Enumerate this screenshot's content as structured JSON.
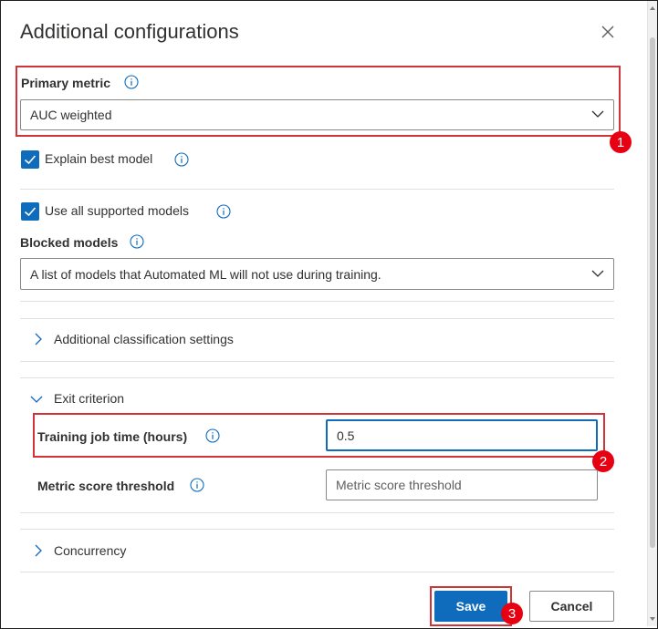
{
  "dialog": {
    "title": "Additional configurations",
    "close_icon": "close-icon"
  },
  "primary_metric": {
    "label": "Primary metric",
    "value": "AUC weighted"
  },
  "explain_best_model": {
    "label": "Explain best model",
    "checked": true
  },
  "use_all_models": {
    "label": "Use all supported models",
    "checked": true
  },
  "blocked_models": {
    "label": "Blocked models",
    "placeholder": "A list of models that Automated ML will not use during training."
  },
  "sections": {
    "classification": {
      "label": "Additional classification settings",
      "expanded": false
    },
    "exit_criterion": {
      "label": "Exit criterion",
      "expanded": true
    },
    "concurrency": {
      "label": "Concurrency",
      "expanded": false
    }
  },
  "training_job_time": {
    "label": "Training job time (hours)",
    "value": "0.5"
  },
  "metric_score_threshold": {
    "label": "Metric score threshold",
    "placeholder": "Metric score threshold"
  },
  "footer": {
    "save_label": "Save",
    "cancel_label": "Cancel"
  },
  "annotations": {
    "badge_1": "1",
    "badge_2": "2",
    "badge_3": "3"
  },
  "colors": {
    "accent": "#0f6cbd",
    "annotation_red": "#d13438",
    "badge_red": "#e60012"
  }
}
